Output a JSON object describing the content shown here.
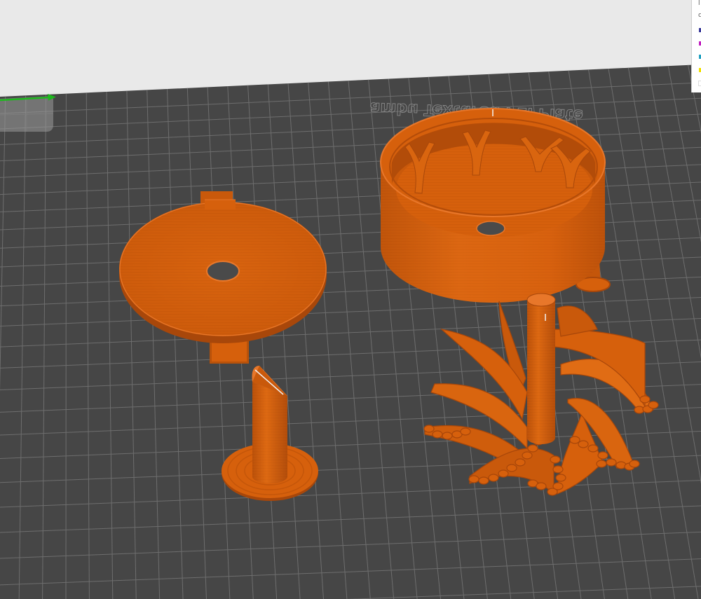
{
  "viewport": {
    "plate_label": "Bambu Textured PEI Plate",
    "plate_label_shown": "ambu Textured PEI Plate"
  },
  "colors": {
    "background": "#e9e9e9",
    "plate": "#464646",
    "grid": "#6e6e6e",
    "filament": "#d6600c",
    "filament_shadow": "#a8470a",
    "filament_highlight": "#e8772a",
    "axis_x": "#1db81d"
  },
  "legend": {
    "chars": [
      "l",
      "c"
    ],
    "swatches": [
      {
        "name": "dark-blue",
        "color": "#3a3a9a"
      },
      {
        "name": "magenta",
        "color": "#c020c0"
      },
      {
        "name": "cyan",
        "color": "#20a0c0"
      },
      {
        "name": "yellow",
        "color": "#f0e000"
      },
      {
        "name": "white",
        "color": "#ffffff"
      }
    ]
  },
  "objects": [
    "round-lid-with-tabs",
    "cylindrical-cup-with-supports",
    "pin-on-disc-base",
    "impeller-with-twisted-blades"
  ]
}
